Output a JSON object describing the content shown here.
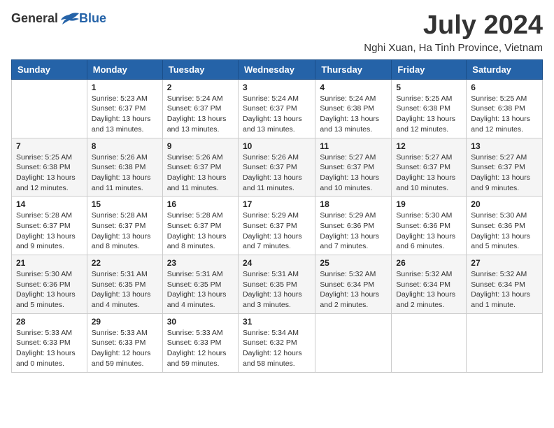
{
  "header": {
    "logo_general": "General",
    "logo_blue": "Blue",
    "month_title": "July 2024",
    "location": "Nghi Xuan, Ha Tinh Province, Vietnam"
  },
  "weekdays": [
    "Sunday",
    "Monday",
    "Tuesday",
    "Wednesday",
    "Thursday",
    "Friday",
    "Saturday"
  ],
  "weeks": [
    [
      {
        "day": "",
        "info": ""
      },
      {
        "day": "1",
        "info": "Sunrise: 5:23 AM\nSunset: 6:37 PM\nDaylight: 13 hours\nand 13 minutes."
      },
      {
        "day": "2",
        "info": "Sunrise: 5:24 AM\nSunset: 6:37 PM\nDaylight: 13 hours\nand 13 minutes."
      },
      {
        "day": "3",
        "info": "Sunrise: 5:24 AM\nSunset: 6:37 PM\nDaylight: 13 hours\nand 13 minutes."
      },
      {
        "day": "4",
        "info": "Sunrise: 5:24 AM\nSunset: 6:38 PM\nDaylight: 13 hours\nand 13 minutes."
      },
      {
        "day": "5",
        "info": "Sunrise: 5:25 AM\nSunset: 6:38 PM\nDaylight: 13 hours\nand 12 minutes."
      },
      {
        "day": "6",
        "info": "Sunrise: 5:25 AM\nSunset: 6:38 PM\nDaylight: 13 hours\nand 12 minutes."
      }
    ],
    [
      {
        "day": "7",
        "info": "Sunrise: 5:25 AM\nSunset: 6:38 PM\nDaylight: 13 hours\nand 12 minutes."
      },
      {
        "day": "8",
        "info": "Sunrise: 5:26 AM\nSunset: 6:38 PM\nDaylight: 13 hours\nand 11 minutes."
      },
      {
        "day": "9",
        "info": "Sunrise: 5:26 AM\nSunset: 6:37 PM\nDaylight: 13 hours\nand 11 minutes."
      },
      {
        "day": "10",
        "info": "Sunrise: 5:26 AM\nSunset: 6:37 PM\nDaylight: 13 hours\nand 11 minutes."
      },
      {
        "day": "11",
        "info": "Sunrise: 5:27 AM\nSunset: 6:37 PM\nDaylight: 13 hours\nand 10 minutes."
      },
      {
        "day": "12",
        "info": "Sunrise: 5:27 AM\nSunset: 6:37 PM\nDaylight: 13 hours\nand 10 minutes."
      },
      {
        "day": "13",
        "info": "Sunrise: 5:27 AM\nSunset: 6:37 PM\nDaylight: 13 hours\nand 9 minutes."
      }
    ],
    [
      {
        "day": "14",
        "info": "Sunrise: 5:28 AM\nSunset: 6:37 PM\nDaylight: 13 hours\nand 9 minutes."
      },
      {
        "day": "15",
        "info": "Sunrise: 5:28 AM\nSunset: 6:37 PM\nDaylight: 13 hours\nand 8 minutes."
      },
      {
        "day": "16",
        "info": "Sunrise: 5:28 AM\nSunset: 6:37 PM\nDaylight: 13 hours\nand 8 minutes."
      },
      {
        "day": "17",
        "info": "Sunrise: 5:29 AM\nSunset: 6:37 PM\nDaylight: 13 hours\nand 7 minutes."
      },
      {
        "day": "18",
        "info": "Sunrise: 5:29 AM\nSunset: 6:36 PM\nDaylight: 13 hours\nand 7 minutes."
      },
      {
        "day": "19",
        "info": "Sunrise: 5:30 AM\nSunset: 6:36 PM\nDaylight: 13 hours\nand 6 minutes."
      },
      {
        "day": "20",
        "info": "Sunrise: 5:30 AM\nSunset: 6:36 PM\nDaylight: 13 hours\nand 5 minutes."
      }
    ],
    [
      {
        "day": "21",
        "info": "Sunrise: 5:30 AM\nSunset: 6:36 PM\nDaylight: 13 hours\nand 5 minutes."
      },
      {
        "day": "22",
        "info": "Sunrise: 5:31 AM\nSunset: 6:35 PM\nDaylight: 13 hours\nand 4 minutes."
      },
      {
        "day": "23",
        "info": "Sunrise: 5:31 AM\nSunset: 6:35 PM\nDaylight: 13 hours\nand 4 minutes."
      },
      {
        "day": "24",
        "info": "Sunrise: 5:31 AM\nSunset: 6:35 PM\nDaylight: 13 hours\nand 3 minutes."
      },
      {
        "day": "25",
        "info": "Sunrise: 5:32 AM\nSunset: 6:34 PM\nDaylight: 13 hours\nand 2 minutes."
      },
      {
        "day": "26",
        "info": "Sunrise: 5:32 AM\nSunset: 6:34 PM\nDaylight: 13 hours\nand 2 minutes."
      },
      {
        "day": "27",
        "info": "Sunrise: 5:32 AM\nSunset: 6:34 PM\nDaylight: 13 hours\nand 1 minute."
      }
    ],
    [
      {
        "day": "28",
        "info": "Sunrise: 5:33 AM\nSunset: 6:33 PM\nDaylight: 13 hours\nand 0 minutes."
      },
      {
        "day": "29",
        "info": "Sunrise: 5:33 AM\nSunset: 6:33 PM\nDaylight: 12 hours\nand 59 minutes."
      },
      {
        "day": "30",
        "info": "Sunrise: 5:33 AM\nSunset: 6:33 PM\nDaylight: 12 hours\nand 59 minutes."
      },
      {
        "day": "31",
        "info": "Sunrise: 5:34 AM\nSunset: 6:32 PM\nDaylight: 12 hours\nand 58 minutes."
      },
      {
        "day": "",
        "info": ""
      },
      {
        "day": "",
        "info": ""
      },
      {
        "day": "",
        "info": ""
      }
    ]
  ]
}
